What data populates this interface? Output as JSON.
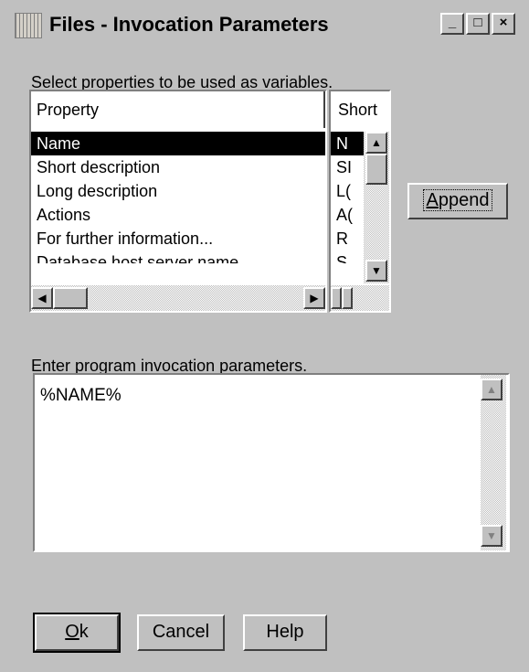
{
  "window": {
    "title": "Files - Invocation Parameters",
    "controls": [
      "_",
      "□",
      "×"
    ]
  },
  "properties": {
    "label": "Select properties to be used as variables.",
    "columns": [
      "Property",
      "Short"
    ],
    "rows": [
      {
        "property": "Name",
        "short": "N",
        "selected": true
      },
      {
        "property": "Short description",
        "short": "SI"
      },
      {
        "property": "Long description",
        "short": "L("
      },
      {
        "property": "Actions",
        "short": "A("
      },
      {
        "property": "For further information...",
        "short": "R"
      },
      {
        "property": "Database host server name",
        "short": "S"
      }
    ]
  },
  "append_button": {
    "label_prefix": "",
    "accel": "A",
    "label_rest": "ppend"
  },
  "params": {
    "label": "Enter program invocation parameters.",
    "value": "%NAME%"
  },
  "buttons": {
    "ok": {
      "accel": "O",
      "rest": "k"
    },
    "cancel": "Cancel",
    "help": "Help"
  }
}
